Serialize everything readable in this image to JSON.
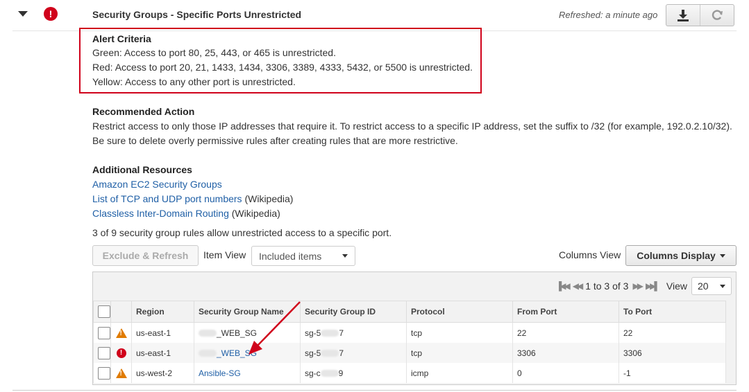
{
  "header": {
    "title": "Security Groups - Specific Ports Unrestricted",
    "refreshed": "Refreshed: a minute ago"
  },
  "alert_criteria": {
    "heading": "Alert Criteria",
    "lines": [
      "Green: Access to port 80, 25, 443, or 465 is unrestricted.",
      "Red: Access to port 20, 21, 1433, 1434, 3306, 3389, 4333, 5432, or 5500 is unrestricted.",
      "Yellow: Access to any other port is unrestricted."
    ]
  },
  "recommended_action": {
    "heading": "Recommended Action",
    "lines": [
      "Restrict access to only those IP addresses that require it. To restrict access to a specific IP address, set the suffix to /32 (for example, 192.0.2.10/32).",
      "Be sure to delete overly permissive rules after creating rules that are more restrictive."
    ]
  },
  "resources": {
    "heading": "Additional Resources",
    "links": [
      {
        "label": "Amazon EC2 Security Groups",
        "suffix": ""
      },
      {
        "label": "List of TCP and UDP port numbers",
        "suffix": " (Wikipedia)"
      },
      {
        "label": "Classless Inter-Domain Routing",
        "suffix": " (Wikipedia)"
      }
    ]
  },
  "summary": "3 of 9 security group rules allow unrestricted access to a specific port.",
  "toolbar": {
    "exclude_refresh": "Exclude & Refresh",
    "item_view_label": "Item View",
    "item_view_value": "Included items",
    "columns_view_label": "Columns View",
    "columns_display": "Columns Display"
  },
  "pager": {
    "range": "1 to 3 of 3",
    "view_label": "View",
    "view_value": "20"
  },
  "table": {
    "columns": [
      "Region",
      "Security Group Name",
      "Security Group ID",
      "Protocol",
      "From Port",
      "To Port"
    ],
    "rows": [
      {
        "status": "warning",
        "region": "us-east-1",
        "name_prefix": "",
        "name": "_WEB_SG",
        "name_link": false,
        "id_prefix": "sg-5",
        "id_suffix": "7",
        "protocol": "tcp",
        "from": "22",
        "to": "22"
      },
      {
        "status": "error",
        "region": "us-east-1",
        "name_prefix": "",
        "name": "_WEB_SG",
        "name_link": true,
        "id_prefix": "sg-5",
        "id_suffix": "7",
        "protocol": "tcp",
        "from": "3306",
        "to": "3306"
      },
      {
        "status": "warning",
        "region": "us-west-2",
        "name_prefix": "",
        "name": "Ansible-SG",
        "name_link": true,
        "id_prefix": "sg-c",
        "id_suffix": "9",
        "protocol": "icmp",
        "from": "0",
        "to": "-1"
      }
    ]
  },
  "colors": {
    "alert_red": "#d0021b",
    "warning_orange": "#e07b00",
    "link_blue": "#1f5fa6"
  }
}
